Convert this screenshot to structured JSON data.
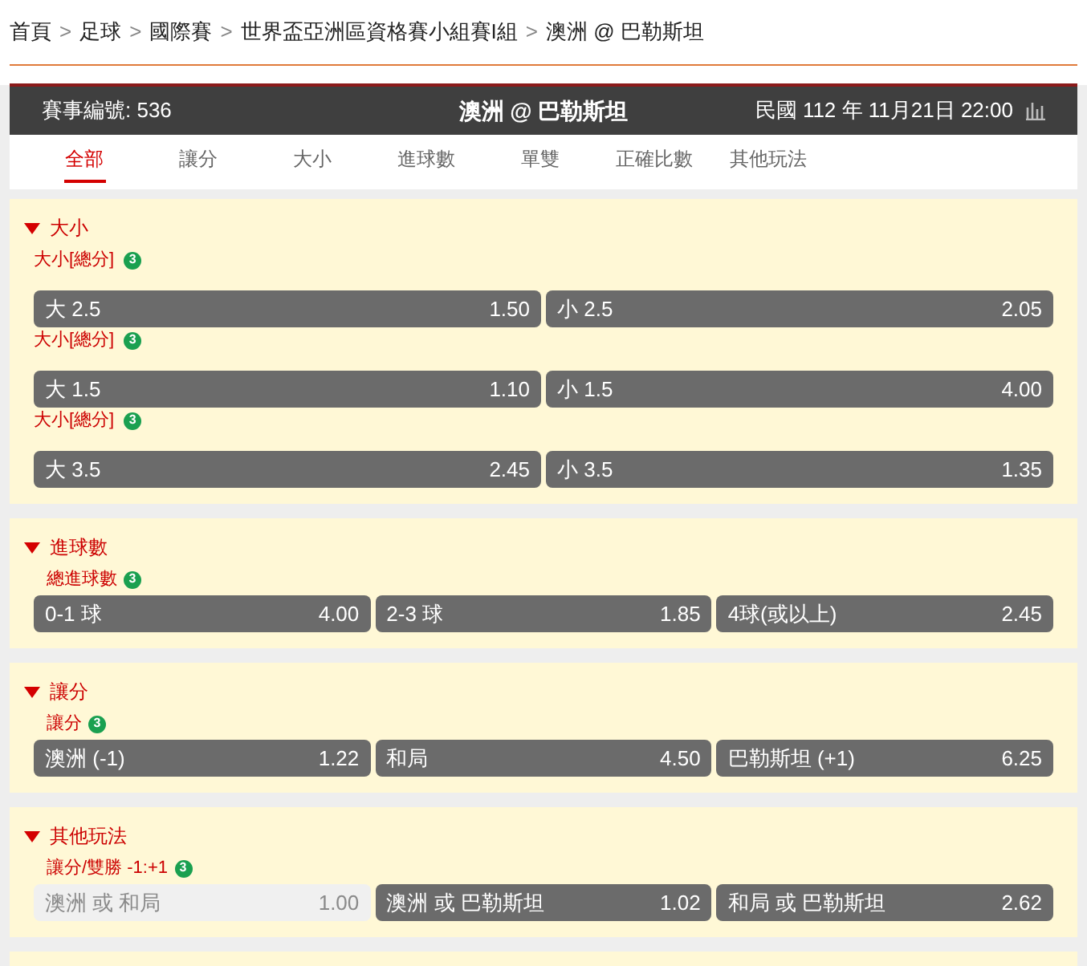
{
  "breadcrumb": [
    "首頁",
    "足球",
    "國際賽",
    "世界盃亞洲區資格賽小組賽I組",
    "澳洲 @ 巴勒斯坦"
  ],
  "breadcrumb_separator": ">",
  "header": {
    "event_number": "賽事編號: 536",
    "title": "澳洲 @ 巴勒斯坦",
    "date": "民國 112 年 11月21日 22:00"
  },
  "tabs": [
    {
      "label": "全部",
      "selected": true
    },
    {
      "label": "讓分",
      "selected": false
    },
    {
      "label": "大小",
      "selected": false
    },
    {
      "label": "進球數",
      "selected": false
    },
    {
      "label": "單雙",
      "selected": false
    },
    {
      "label": "正確比數",
      "selected": false
    },
    {
      "label": "其他玩法",
      "selected": false
    }
  ],
  "sections": [
    {
      "title": "大小",
      "expanded": true,
      "markets": [
        {
          "label": "大小[總分]",
          "badge": "3",
          "options": [
            {
              "label": "大 2.5",
              "odds": "1.50",
              "disabled": false
            },
            {
              "label": "小 2.5",
              "odds": "2.05",
              "disabled": false
            }
          ]
        },
        {
          "label": "大小[總分]",
          "badge": "3",
          "options": [
            {
              "label": "大 1.5",
              "odds": "1.10",
              "disabled": false
            },
            {
              "label": "小 1.5",
              "odds": "4.00",
              "disabled": false
            }
          ]
        },
        {
          "label": "大小[總分]",
          "badge": "3",
          "options": [
            {
              "label": "大 3.5",
              "odds": "2.45",
              "disabled": false
            },
            {
              "label": "小 3.5",
              "odds": "1.35",
              "disabled": false
            }
          ]
        }
      ]
    },
    {
      "title": "進球數",
      "expanded": true,
      "markets": [
        {
          "label": "總進球數",
          "badge": "3",
          "options": [
            {
              "label": "0-1 球",
              "odds": "4.00",
              "disabled": false
            },
            {
              "label": "2-3 球",
              "odds": "1.85",
              "disabled": false
            },
            {
              "label": "4球(或以上)",
              "odds": "2.45",
              "disabled": false
            }
          ]
        }
      ]
    },
    {
      "title": "讓分",
      "expanded": true,
      "markets": [
        {
          "label": "讓分",
          "badge": "3",
          "options": [
            {
              "label": "澳洲 (-1)",
              "odds": "1.22",
              "disabled": false
            },
            {
              "label": "和局",
              "odds": "4.50",
              "disabled": false
            },
            {
              "label": "巴勒斯坦 (+1)",
              "odds": "6.25",
              "disabled": false
            }
          ]
        }
      ]
    },
    {
      "title": "其他玩法",
      "expanded": true,
      "markets": [
        {
          "label": "讓分/雙勝 -1:+1",
          "badge": "3",
          "options": [
            {
              "label": "澳洲 或 和局",
              "odds": "1.00",
              "disabled": true
            },
            {
              "label": "澳洲 或 巴勒斯坦",
              "odds": "1.02",
              "disabled": false
            },
            {
              "label": "和局 或 巴勒斯坦",
              "odds": "2.62",
              "disabled": false
            }
          ]
        }
      ]
    }
  ]
}
